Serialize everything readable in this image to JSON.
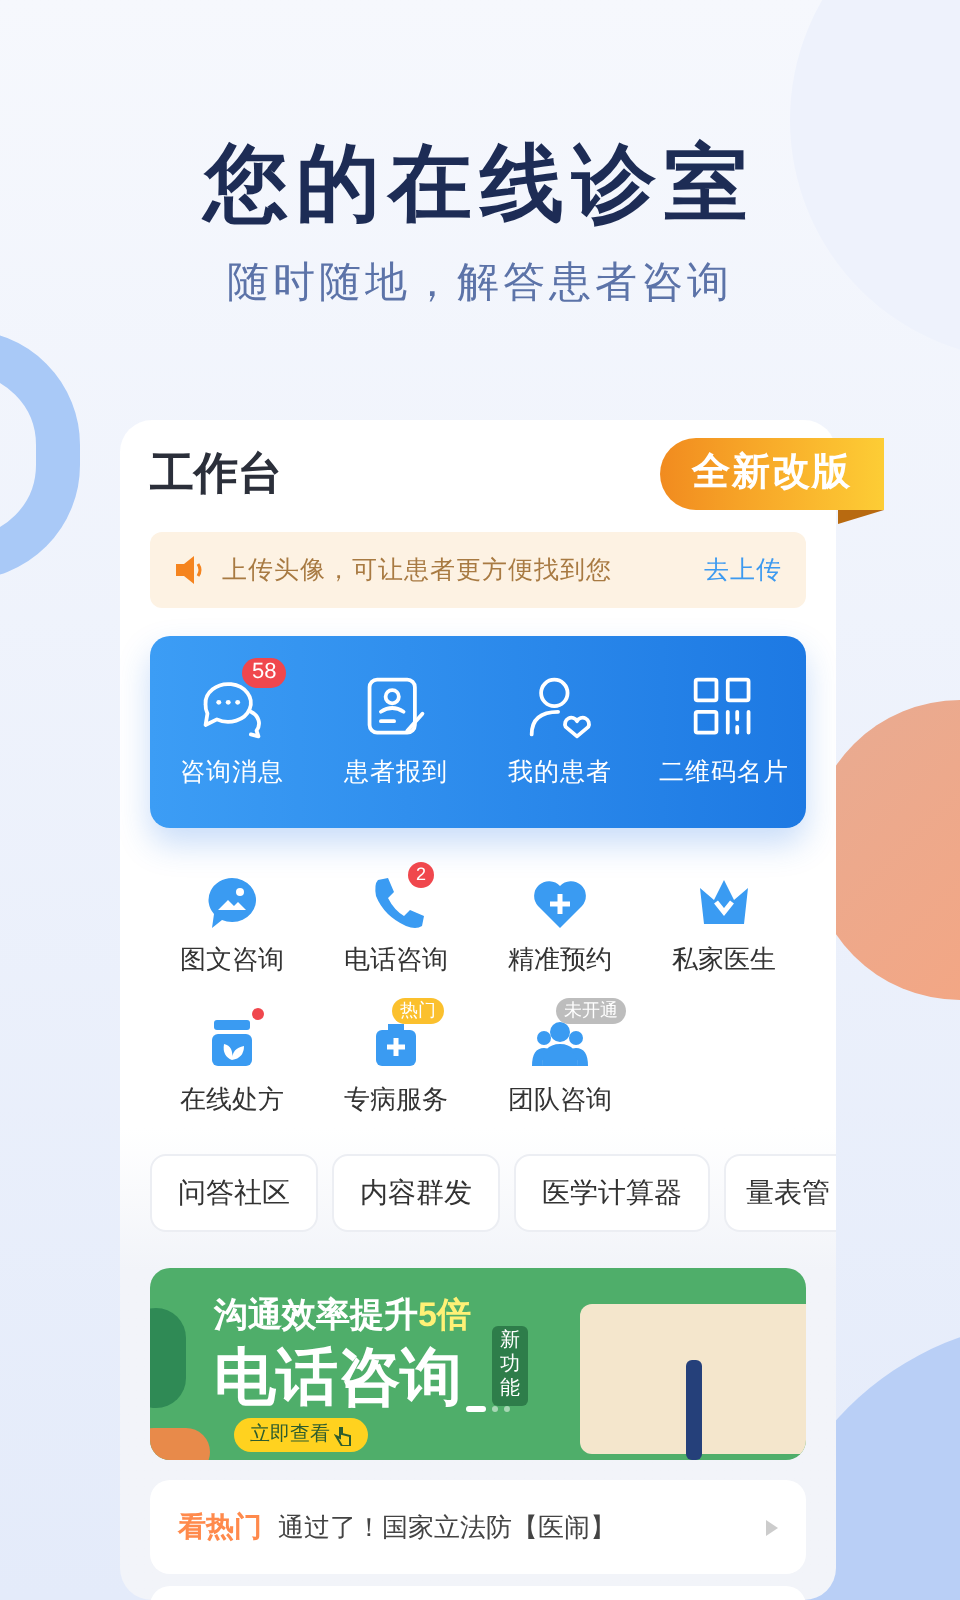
{
  "hero": {
    "title": "您的在线诊室",
    "subtitle": "随时随地，解答患者咨询"
  },
  "card": {
    "title": "工作台",
    "ribbon": "全新改版"
  },
  "notice": {
    "text": "上传头像，可让患者更方便找到您",
    "link": "去上传"
  },
  "quick_actions": [
    {
      "label": "咨询消息",
      "badge": "58"
    },
    {
      "label": "患者报到"
    },
    {
      "label": "我的患者"
    },
    {
      "label": "二维码名片"
    }
  ],
  "services": [
    {
      "label": "图文咨询"
    },
    {
      "label": "电话咨询",
      "badge": {
        "kind": "count",
        "text": "2"
      }
    },
    {
      "label": "精准预约"
    },
    {
      "label": "私家医生"
    },
    {
      "label": "在线处方",
      "badge": {
        "kind": "dot"
      }
    },
    {
      "label": "专病服务",
      "badge": {
        "kind": "tag",
        "text": "热门",
        "color": "#fbc02d"
      }
    },
    {
      "label": "团队咨询",
      "badge": {
        "kind": "tag",
        "text": "未开通",
        "color": "#bdbdbd"
      }
    }
  ],
  "tools": [
    "问答社区",
    "内容群发",
    "医学计算器",
    "量表管"
  ],
  "banner": {
    "headline": "沟通效率提升",
    "highlight": "5倍",
    "title": "电话咨询",
    "tag": "新功能",
    "button": "立即查看",
    "dots": [
      {
        "selected": true
      },
      {
        "selected": false
      },
      {
        "selected": false
      }
    ]
  },
  "news": {
    "label": "看热门",
    "text": "通过了！国家立法防【医闹】"
  }
}
